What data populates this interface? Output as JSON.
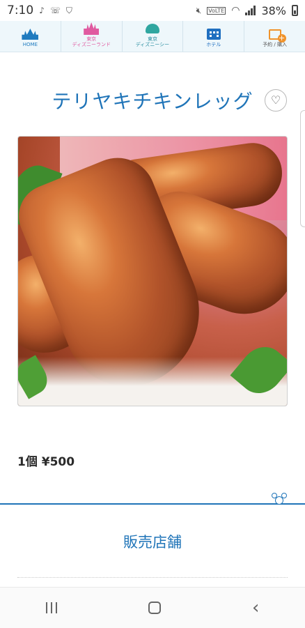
{
  "status_bar": {
    "time": "7:10",
    "left_icons": [
      "music-note-icon",
      "call-icon",
      "shield-icon"
    ],
    "right_icons": [
      "mute-icon",
      "volte-icon",
      "wifi-icon",
      "signal-icon",
      "battery-icon"
    ],
    "volte_label": "VoLTE",
    "battery_percent": "38%"
  },
  "top_nav": {
    "items": [
      {
        "label": "HOME",
        "color": "#1f7bbf",
        "icon": "castle-icon"
      },
      {
        "label": "東京\nディズニーランド",
        "color": "#e05aa0",
        "icon": "castle-pink-icon"
      },
      {
        "label": "東京\nディズニーシー",
        "color": "#2a8ea0",
        "icon": "globe-icon"
      },
      {
        "label": "ホテル",
        "color": "#1f6fc0",
        "icon": "hotel-icon"
      },
      {
        "label": "予約 / 購入",
        "color": "#555555",
        "icon": "ticket-icon"
      }
    ]
  },
  "product": {
    "title": "テリヤキチキンレッグ",
    "price_label": "1個 ¥500",
    "image_alt": "chicken-leg-photo"
  },
  "sections": {
    "shop_heading": "販売店舗"
  },
  "colors": {
    "accent": "#1f74b8",
    "nav_bg": "#eef7fb"
  }
}
